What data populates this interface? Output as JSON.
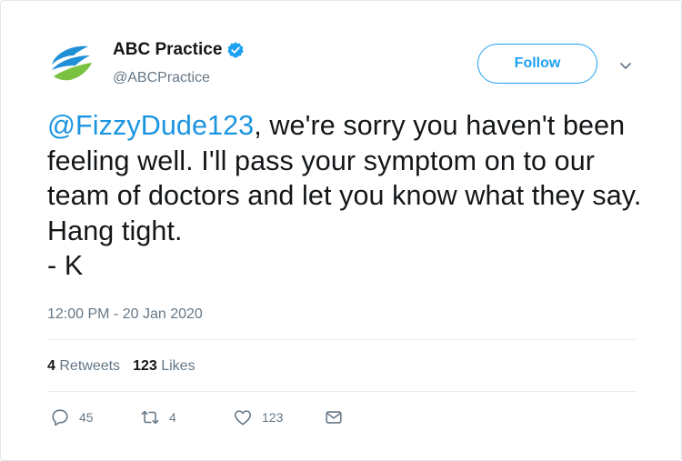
{
  "account": {
    "display_name": "ABC Practice",
    "handle": "@ABCPractice",
    "verified_icon": "verified-badge-icon",
    "logo_colors": [
      "#1f8fd6",
      "#7cc242"
    ]
  },
  "follow_label": "Follow",
  "tweet": {
    "mention": "@FizzyDude123",
    "text": ", we're sorry you haven't been feeling well. I'll pass your symptom on to our team of doctors and let you know what they say. Hang tight.",
    "signature": "- K",
    "timestamp": "12:00 PM - 20 Jan 2020"
  },
  "stats": {
    "retweets_count": "4",
    "retweets_label": "Retweets",
    "likes_count": "123",
    "likes_label": "Likes"
  },
  "actions": {
    "reply_count": "45",
    "retweet_count": "4",
    "like_count": "123"
  },
  "colors": {
    "accent": "#1da1f2",
    "mention": "#1b95e0",
    "muted": "#657786"
  }
}
